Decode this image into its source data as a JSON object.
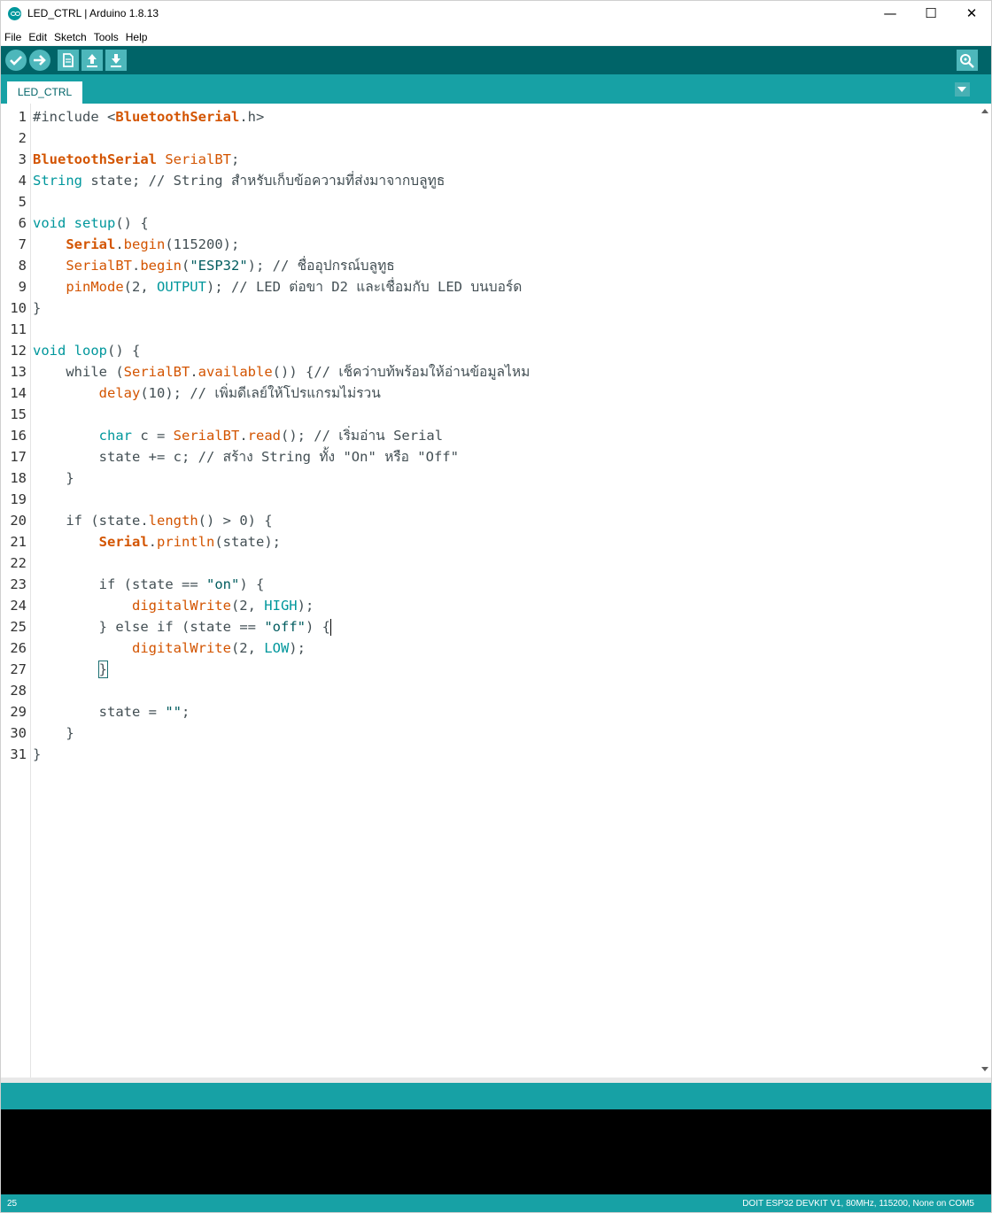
{
  "window": {
    "title": "LED_CTRL | Arduino 1.8.13",
    "minimize_glyph": "—",
    "maximize_glyph": "☐",
    "close_glyph": "✕"
  },
  "menu": [
    "File",
    "Edit",
    "Sketch",
    "Tools",
    "Help"
  ],
  "toolbar": {
    "icons": [
      "verify-icon",
      "upload-icon",
      "new-icon",
      "open-icon",
      "save-icon",
      "serial-monitor-icon"
    ]
  },
  "tabs": [
    {
      "label": "LED_CTRL"
    }
  ],
  "code": {
    "line_numbers": [
      "1",
      "2",
      "3",
      "4",
      "5",
      "6",
      "7",
      "8",
      "9",
      "10",
      "11",
      "12",
      "13",
      "14",
      "15",
      "16",
      "17",
      "18",
      "19",
      "20",
      "21",
      "22",
      "23",
      "24",
      "25",
      "26",
      "27",
      "28",
      "29",
      "30",
      "31"
    ],
    "l1": {
      "a": "#include <",
      "b": "BluetoothSerial",
      "c": ".h>"
    },
    "l3": {
      "a": "BluetoothSerial",
      "b": " ",
      "c": "SerialBT",
      "d": ";"
    },
    "l4": {
      "a": "String",
      "b": " state; // String สำหรับเก็บข้อความที่ส่งมาจากบลูทูธ"
    },
    "l6": {
      "a": "void",
      "b": " ",
      "c": "setup",
      "d": "() {"
    },
    "l7": {
      "a": "    ",
      "b": "Serial",
      "c": ".",
      "d": "begin",
      "e": "(115200);"
    },
    "l8": {
      "a": "    ",
      "b": "SerialBT",
      "c": ".",
      "d": "begin",
      "e": "(",
      "f": "\"ESP32\"",
      "g": "); // ชื่ออุปกรณ์บลูทูธ"
    },
    "l9": {
      "a": "    ",
      "b": "pinMode",
      "c": "(2, ",
      "d": "OUTPUT",
      "e": "); // LED ต่อขา D2 และเชื่อมกับ LED บนบอร์ด"
    },
    "l10": {
      "a": "}"
    },
    "l12": {
      "a": "void",
      "b": " ",
      "c": "loop",
      "d": "() {"
    },
    "l13": {
      "a": "    ",
      "b": "while",
      "c": " (",
      "d": "SerialBT",
      "e": ".",
      "f": "available",
      "g": "()) {// เช็คว่าบท้พร้อมให้อ่านข้อมูลไหม"
    },
    "l14": {
      "a": "        ",
      "b": "delay",
      "c": "(10); // เพิ่มดีเลย์ให้โปรแกรมไม่รวน"
    },
    "l16": {
      "a": "        ",
      "b": "char",
      "c": " c = ",
      "d": "SerialBT",
      "e": ".",
      "f": "read",
      "g": "(); // เริ่มอ่าน Serial"
    },
    "l17": {
      "a": "        state += c; // สร้าง String ทั้ง \"On\" หรือ \"Off\""
    },
    "l18": {
      "a": "    }"
    },
    "l20": {
      "a": "    ",
      "b": "if",
      "c": " (state.",
      "d": "length",
      "e": "() > 0) {"
    },
    "l21": {
      "a": "        ",
      "b": "Serial",
      "c": ".",
      "d": "println",
      "e": "(state);"
    },
    "l23": {
      "a": "        ",
      "b": "if",
      "c": " (state == ",
      "d": "\"on\"",
      "e": ") {"
    },
    "l24": {
      "a": "            ",
      "b": "digitalWrite",
      "c": "(2, ",
      "d": "HIGH",
      "e": ");"
    },
    "l25": {
      "a": "        } ",
      "b": "else",
      "c": " ",
      "d": "if",
      "e": " (state == ",
      "f": "\"off\"",
      "g": ") {"
    },
    "l26": {
      "a": "            ",
      "b": "digitalWrite",
      "c": "(2, ",
      "d": "LOW",
      "e": ");"
    },
    "l27": {
      "a": "        ",
      "b": "}"
    },
    "l29": {
      "a": "        state = ",
      "b": "\"\"",
      "c": ";"
    },
    "l30": {
      "a": "    }"
    },
    "l31": {
      "a": "}"
    }
  },
  "statusbar": {
    "line": "25",
    "board": "DOIT ESP32 DEVKIT V1, 80MHz, 115200, None on COM5"
  },
  "colors": {
    "toolbar": "#006468",
    "tabbar": "#17a1a5",
    "keyword": "#00979c",
    "function": "#d35400",
    "comment": "#434f54",
    "string": "#005c5f"
  }
}
